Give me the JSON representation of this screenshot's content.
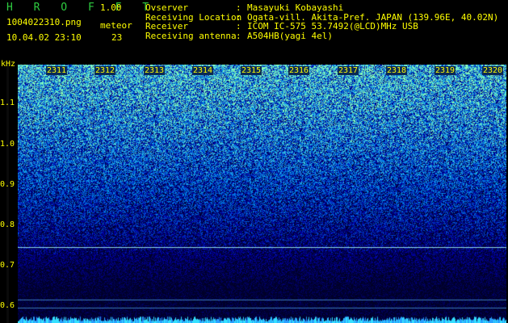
{
  "app": {
    "logo": "H R O F F T",
    "version": "1.00"
  },
  "file": {
    "name": "1004022310.png",
    "datetime": "10.04.02 23:10"
  },
  "meteor": {
    "label": "meteor",
    "count": "23"
  },
  "info": [
    {
      "key": "Ovserver",
      "value": "Masayuki Kobayashi"
    },
    {
      "key": "Receiving Location",
      "value": "Ogata-vill. Akita-Pref. JAPAN (139.96E, 40.02N)"
    },
    {
      "key": "Receiver",
      "value": "ICOM IC-575 53.7492(@LCD)MHz USB"
    },
    {
      "key": "Receiving antenna",
      "value": "A504HB(yagi 4el)"
    }
  ],
  "axis": {
    "unit": "kHz",
    "y_ticks": [
      "1.1",
      "1.0",
      "0.9",
      "0.8",
      "0.7",
      "0.6"
    ],
    "x_ticks": [
      "2311",
      "2312",
      "2313",
      "2314",
      "2315",
      "2316",
      "2317",
      "2318",
      "2319",
      "2320"
    ]
  },
  "colors": {
    "text": "#ffff00",
    "logo": "#2ecc40",
    "background": "#000000",
    "spectrum_low": "#0a0a5a",
    "spectrum_high": "#2ad0ff"
  }
}
